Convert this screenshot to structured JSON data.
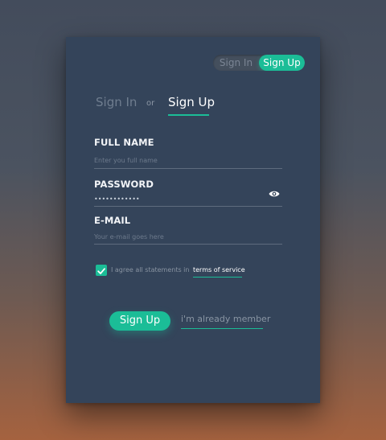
{
  "toggle": {
    "signin_label": "Sign In",
    "signup_label": "Sign Up",
    "active": "signup"
  },
  "tabs": {
    "signin_label": "Sign In",
    "separator": "or",
    "signup_label": "Sign Up"
  },
  "form": {
    "full_name": {
      "label": "FULL NAME",
      "placeholder": "Enter you full name",
      "value": ""
    },
    "password": {
      "label": "PASSWORD",
      "value": "••••••••••••",
      "icon": "eye-icon"
    },
    "email": {
      "label": "E-MAIL",
      "placeholder": "Your e-mail goes here",
      "value": ""
    },
    "agree": {
      "text": "I agree all statements in",
      "link_label": "terms of service",
      "checked": true
    }
  },
  "actions": {
    "submit_label": "Sign Up",
    "already_member_label": "i'm already member"
  },
  "colors": {
    "accent": "#1bbd97",
    "card": "#34445a",
    "toggle_bg": "#444f5d",
    "background_top": "#434c5c",
    "background_bottom": "#a5623f"
  }
}
